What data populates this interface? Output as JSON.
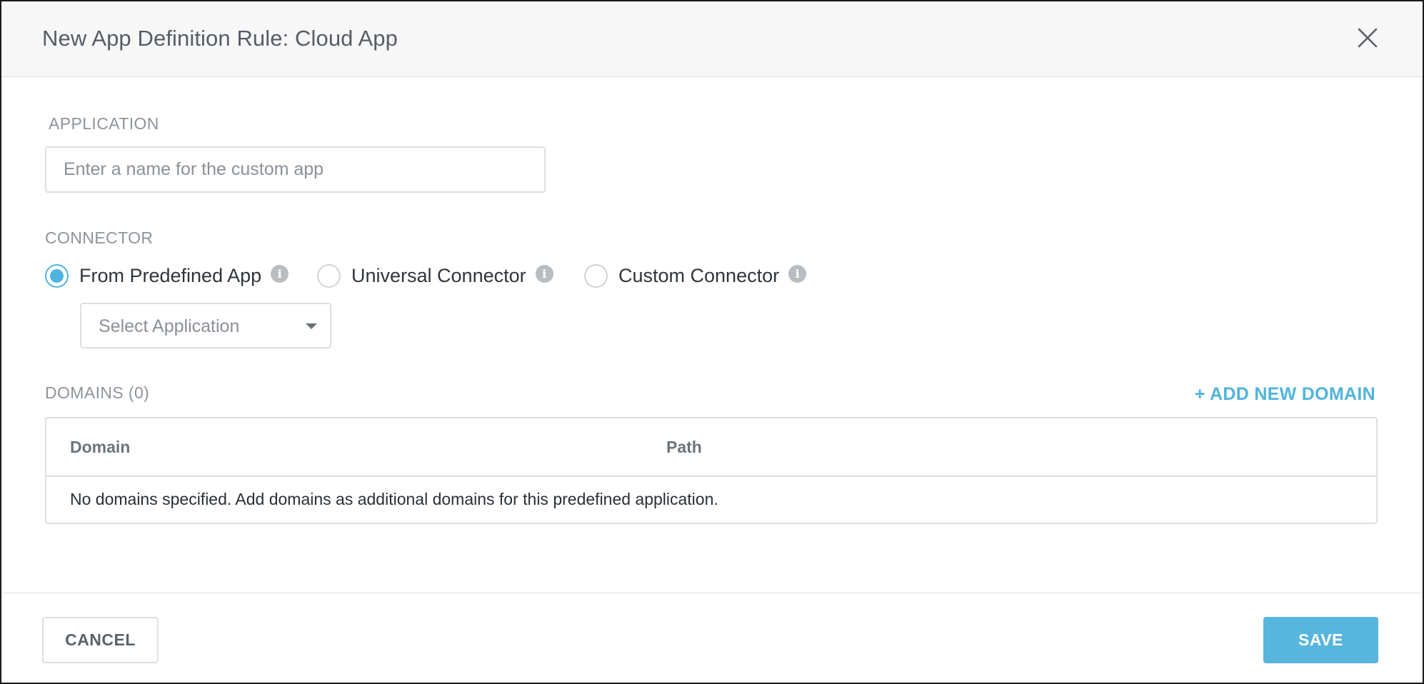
{
  "dialog": {
    "title": "New App Definition Rule: Cloud App",
    "close_icon": "close-icon"
  },
  "application": {
    "label": "APPLICATION",
    "value": "",
    "placeholder": "Enter a name for the custom app"
  },
  "connector": {
    "label": "CONNECTOR",
    "options": [
      {
        "label": "From Predefined App",
        "checked": true,
        "info_icon": "info-icon"
      },
      {
        "label": "Universal Connector",
        "checked": false,
        "info_icon": "info-icon"
      },
      {
        "label": "Custom Connector",
        "checked": false,
        "info_icon": "info-icon"
      }
    ],
    "select": {
      "placeholder": "Select Application",
      "icon": "chevron-down-icon"
    }
  },
  "domains": {
    "label": "DOMAINS (0)",
    "add_label": "+ ADD NEW DOMAIN",
    "columns": [
      "Domain",
      "Path"
    ],
    "empty_text": "No domains specified. Add domains as additional domains for this predefined application."
  },
  "footer": {
    "cancel_label": "CANCEL",
    "save_label": "SAVE"
  },
  "colors": {
    "accent": "#4fb4dc",
    "save_button": "#57b5de",
    "header_bg": "#f7f7f8"
  }
}
